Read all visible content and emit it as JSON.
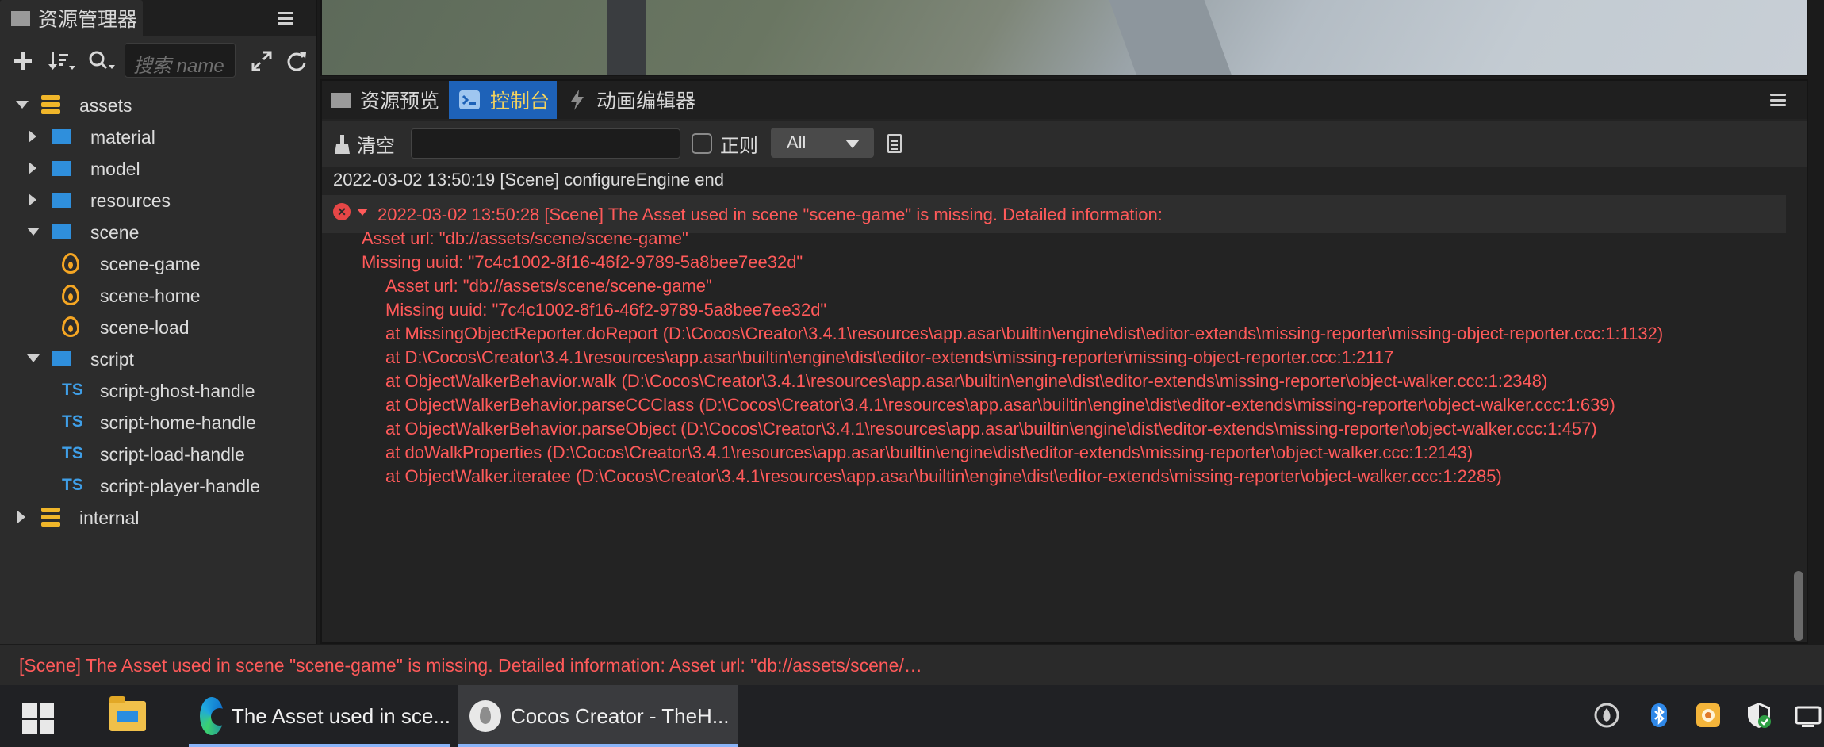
{
  "assets_panel": {
    "tab_label": "资源管理器",
    "search_placeholder": "搜索 name",
    "tree": [
      {
        "label": "assets",
        "type": "db",
        "depth": 0,
        "expanded": true
      },
      {
        "label": "material",
        "type": "folder",
        "depth": 1,
        "expanded": false
      },
      {
        "label": "model",
        "type": "folder",
        "depth": 1,
        "expanded": false
      },
      {
        "label": "resources",
        "type": "folder",
        "depth": 1,
        "expanded": false
      },
      {
        "label": "scene",
        "type": "folder",
        "depth": 1,
        "expanded": true
      },
      {
        "label": "scene-game",
        "type": "scene",
        "depth": 2
      },
      {
        "label": "scene-home",
        "type": "scene",
        "depth": 2
      },
      {
        "label": "scene-load",
        "type": "scene",
        "depth": 2
      },
      {
        "label": "script",
        "type": "folder",
        "depth": 1,
        "expanded": true
      },
      {
        "label": "script-ghost-handle",
        "type": "ts",
        "depth": 2
      },
      {
        "label": "script-home-handle",
        "type": "ts",
        "depth": 2
      },
      {
        "label": "script-load-handle",
        "type": "ts",
        "depth": 2
      },
      {
        "label": "script-player-handle",
        "type": "ts",
        "depth": 2
      },
      {
        "label": "internal",
        "type": "db",
        "depth": 0,
        "expanded": false
      }
    ],
    "ts_badge": "TS"
  },
  "console": {
    "tabs": [
      {
        "label": "资源预览",
        "icon": "folder-icon",
        "active": false
      },
      {
        "label": "控制台",
        "icon": "terminal-icon",
        "active": true
      },
      {
        "label": "动画编辑器",
        "icon": "animation-icon",
        "active": false
      }
    ],
    "clear_label": "清空",
    "regex_label": "正则",
    "level_select": "All",
    "error_icon_glyph": "×",
    "logs": [
      {
        "text": "2022-03-02 13:50:19 [Scene] configureEngine end",
        "kind": "normal",
        "indent": 0
      },
      {
        "text": "2022-03-02 13:50:28 [Scene] The Asset used in scene \"scene-game\" is missing. Detailed information:",
        "kind": "err-head",
        "indent": 0
      },
      {
        "text": "Asset url: \"db://assets/scene/scene-game\"",
        "kind": "err",
        "indent": 1
      },
      {
        "text": "Missing uuid: \"7c4c1002-8f16-46f2-9789-5a8bee7ee32d\"",
        "kind": "err",
        "indent": 1
      },
      {
        "text": "Asset url: \"db://assets/scene/scene-game\"",
        "kind": "err",
        "indent": 2
      },
      {
        "text": "Missing uuid: \"7c4c1002-8f16-46f2-9789-5a8bee7ee32d\"",
        "kind": "err",
        "indent": 2
      },
      {
        "text": "at MissingObjectReporter.doReport (D:\\Cocos\\Creator\\3.4.1\\resources\\app.asar\\builtin\\engine\\dist\\editor-extends\\missing-reporter\\missing-object-reporter.ccc:1:1132)",
        "kind": "err",
        "indent": 2
      },
      {
        "text": "at D:\\Cocos\\Creator\\3.4.1\\resources\\app.asar\\builtin\\engine\\dist\\editor-extends\\missing-reporter\\missing-object-reporter.ccc:1:2117",
        "kind": "err",
        "indent": 2
      },
      {
        "text": "at ObjectWalkerBehavior.walk (D:\\Cocos\\Creator\\3.4.1\\resources\\app.asar\\builtin\\engine\\dist\\editor-extends\\missing-reporter\\object-walker.ccc:1:2348)",
        "kind": "err",
        "indent": 2
      },
      {
        "text": "at ObjectWalkerBehavior.parseCCClass (D:\\Cocos\\Creator\\3.4.1\\resources\\app.asar\\builtin\\engine\\dist\\editor-extends\\missing-reporter\\object-walker.ccc:1:639)",
        "kind": "err",
        "indent": 2
      },
      {
        "text": "at ObjectWalkerBehavior.parseObject (D:\\Cocos\\Creator\\3.4.1\\resources\\app.asar\\builtin\\engine\\dist\\editor-extends\\missing-reporter\\object-walker.ccc:1:457)",
        "kind": "err",
        "indent": 2
      },
      {
        "text": "at doWalkProperties (D:\\Cocos\\Creator\\3.4.1\\resources\\app.asar\\builtin\\engine\\dist\\editor-extends\\missing-reporter\\object-walker.ccc:1:2143)",
        "kind": "err",
        "indent": 2
      },
      {
        "text": "at ObjectWalker.iteratee (D:\\Cocos\\Creator\\3.4.1\\resources\\app.asar\\builtin\\engine\\dist\\editor-extends\\missing-reporter\\object-walker.ccc:1:2285)",
        "kind": "err",
        "indent": 2
      }
    ]
  },
  "status_bar": {
    "text": "[Scene] The Asset used in scene \"scene-game\" is missing. Detailed information: Asset url: \"db://assets/scene/…"
  },
  "taskbar": {
    "apps": [
      {
        "label": "The Asset used in sce...",
        "icon": "edge-icon",
        "active": false
      },
      {
        "label": "Cocos Creator - TheH...",
        "icon": "cocos-creator-icon",
        "active": true
      }
    ],
    "tray_icons": [
      "cocos-tray-icon",
      "bluetooth-icon",
      "app-tray-icon",
      "security-shield-icon",
      "network-icon"
    ]
  },
  "colors": {
    "error_text": "#ff5a5a",
    "active_tab": "#1e62b8",
    "active_tab_text": "#f4d35e",
    "folder": "#2f8fdc",
    "db": "#f0b62a",
    "scene": "#f5a623",
    "ts": "#3f9fe8"
  }
}
